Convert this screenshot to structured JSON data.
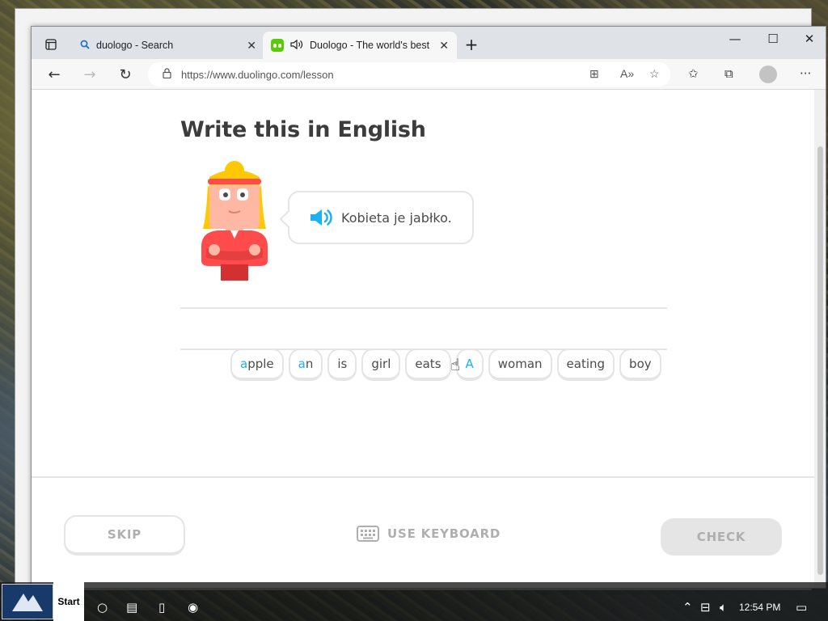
{
  "browser": {
    "tabs": [
      {
        "title": "duologo - Search",
        "icon": "search-icon"
      },
      {
        "title": "Duologo - The world's best",
        "icon": "duolingo-favicon"
      }
    ],
    "url": "https://www.duolingo.com/lesson"
  },
  "lesson": {
    "heading": "Write this in English",
    "prompt": "Kobieta je jabłko.",
    "word_bank": [
      "apple",
      "an",
      "is",
      "girl",
      "eats",
      "A",
      "woman",
      "eating",
      "boy"
    ]
  },
  "footer": {
    "skip_label": "SKIP",
    "keyboard_label": "USE KEYBOARD",
    "check_label": "CHECK"
  },
  "taskbar": {
    "start_label": "Start",
    "time": "12:54 PM"
  },
  "colors": {
    "accent_blue": "#1cb0f6",
    "brand_green": "#58cc02",
    "border_gray": "#e5e5e5",
    "disabled_text": "#afafaf"
  }
}
